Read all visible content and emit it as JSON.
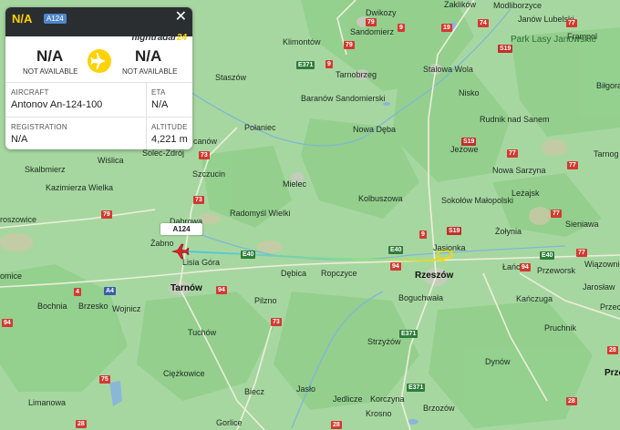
{
  "flight_card": {
    "callsign": "N/A",
    "type_badge": "A124",
    "logo_main": "flightradar",
    "logo_num": "24",
    "close_glyph": "✕",
    "origin": {
      "code": "N/A",
      "name": "NOT AVAILABLE"
    },
    "destination": {
      "code": "N/A",
      "name": "NOT AVAILABLE"
    },
    "aircraft_label": "AIRCRAFT",
    "aircraft_value": "Antonov An-124-100",
    "eta_label": "ETA",
    "eta_value": "N/A",
    "registration_label": "REGISTRATION",
    "registration_value": "N/A",
    "altitude_label": "ALTITUDE",
    "altitude_value": "4,221 m"
  },
  "aircraft_marker_label": "A124",
  "colors": {
    "land": "#a7d7a0",
    "forest": "#8ccb86",
    "mountain": "#c7c6a6",
    "track_start": "#ffd700",
    "track_end": "#4fc2e8",
    "aircraft": "#e0212b",
    "card_header": "#2b2e31",
    "accent": "#ffd200"
  },
  "places": {
    "dwikozy": "Dwikozy",
    "modliborzyce": "Modliborzyce",
    "sandomierz": "Sandomierz",
    "zaklikow": "Zaklików",
    "janow_lubelski": "Janów Lubelski",
    "frampol": "Frampol",
    "klimontow": "Klimontów",
    "park_lasy": "Park Lasy Janowskie",
    "staszow": "Staszów",
    "tarnobrzeg": "Tarnobrzeg",
    "stalowa_wola": "Stalowa Wola",
    "bilgoraj": "Biłgora",
    "baranow": "Baranów Sandomierski",
    "nisko": "Nisko",
    "polaniec": "Połaniec",
    "nowa_deba": "Nowa Dęba",
    "rudnik": "Rudnik nad Sanem",
    "csanow": "canów",
    "solec": "Solec-Zdrój",
    "jezowe": "Jeżowe",
    "wislica": "Wiślica",
    "tarnog": "Tarnog",
    "skalbmierz": "Skalbmierz",
    "szczucin": "Szczucin",
    "mielec": "Mielec",
    "nowa_sarzyna": "Nowa Sarzyna",
    "kazimierza": "Kazimierza Wielka",
    "kolbuszowa": "Kolbuszowa",
    "lezajsk": "Leżajsk",
    "proszowice": "roszowice",
    "sokolow": "Sokołów Małopolski",
    "radomysl": "Radomyśl Wielki",
    "dabrowa": "Dąbrowa",
    "siedniawa": "Sieniawa",
    "zolynia": "Żołynia",
    "zabno": "Żabno",
    "jasionka": "Jasionka",
    "lisia_gora": "Lisia Góra",
    "omice": "omice",
    "debica": "Dębica",
    "ropczyce": "Ropczyce",
    "rzeszow": "Rzeszów",
    "lancut": "Łańcut",
    "przeworsk": "Przeworsk",
    "wiazownica": "Wiązownic",
    "jaroslaw": "Jarosław",
    "tarnow": "Tarnów",
    "bochnia": "Bochnia",
    "brzesko": "Brzesko",
    "wojnicz": "Wojnicz",
    "boguchwala": "Boguchwała",
    "pilzno": "Pilzno",
    "kanczuga": "Kańczuga",
    "drzec": "Przec",
    "pruchnik": "Pruchnik",
    "tuchow": "Tuchów",
    "strzyzow": "Strzyżów",
    "dynow": "Dynów",
    "ciezkowice": "Ciężkowice",
    "limanowa": "Limanowa",
    "biecz": "Biecz",
    "jaslo": "Jasło",
    "jedlicze": "Jedlicze",
    "korczyna": "Korczyna",
    "brzozow": "Brzozów",
    "krosno": "Krosno",
    "gorlice": "Gorlice",
    "przem": "Prze"
  },
  "roads": {
    "r79a": "79",
    "r9a": "9",
    "r74": "74",
    "r19a": "19",
    "r77a": "77",
    "s19a": "S19",
    "e371a": "E371",
    "r9b": "9",
    "r79b": "79",
    "s19b": "S19",
    "r77b": "77",
    "r73a": "73",
    "r79c": "79",
    "r9c": "9",
    "s19c": "S19",
    "r77c": "77",
    "r77d": "77",
    "r73b": "73",
    "e40a": "E40",
    "e40b": "E40",
    "e40c": "E40",
    "r94a": "94",
    "r94b": "94",
    "a4a": "A4",
    "r94c": "94",
    "r73c": "73",
    "e371b": "E371",
    "r28a": "28",
    "r75": "75",
    "e371c": "E371",
    "r28b": "28",
    "r28c": "28",
    "r28d": "28",
    "r77e": "77",
    "r4": "4",
    "r94d": "94"
  }
}
